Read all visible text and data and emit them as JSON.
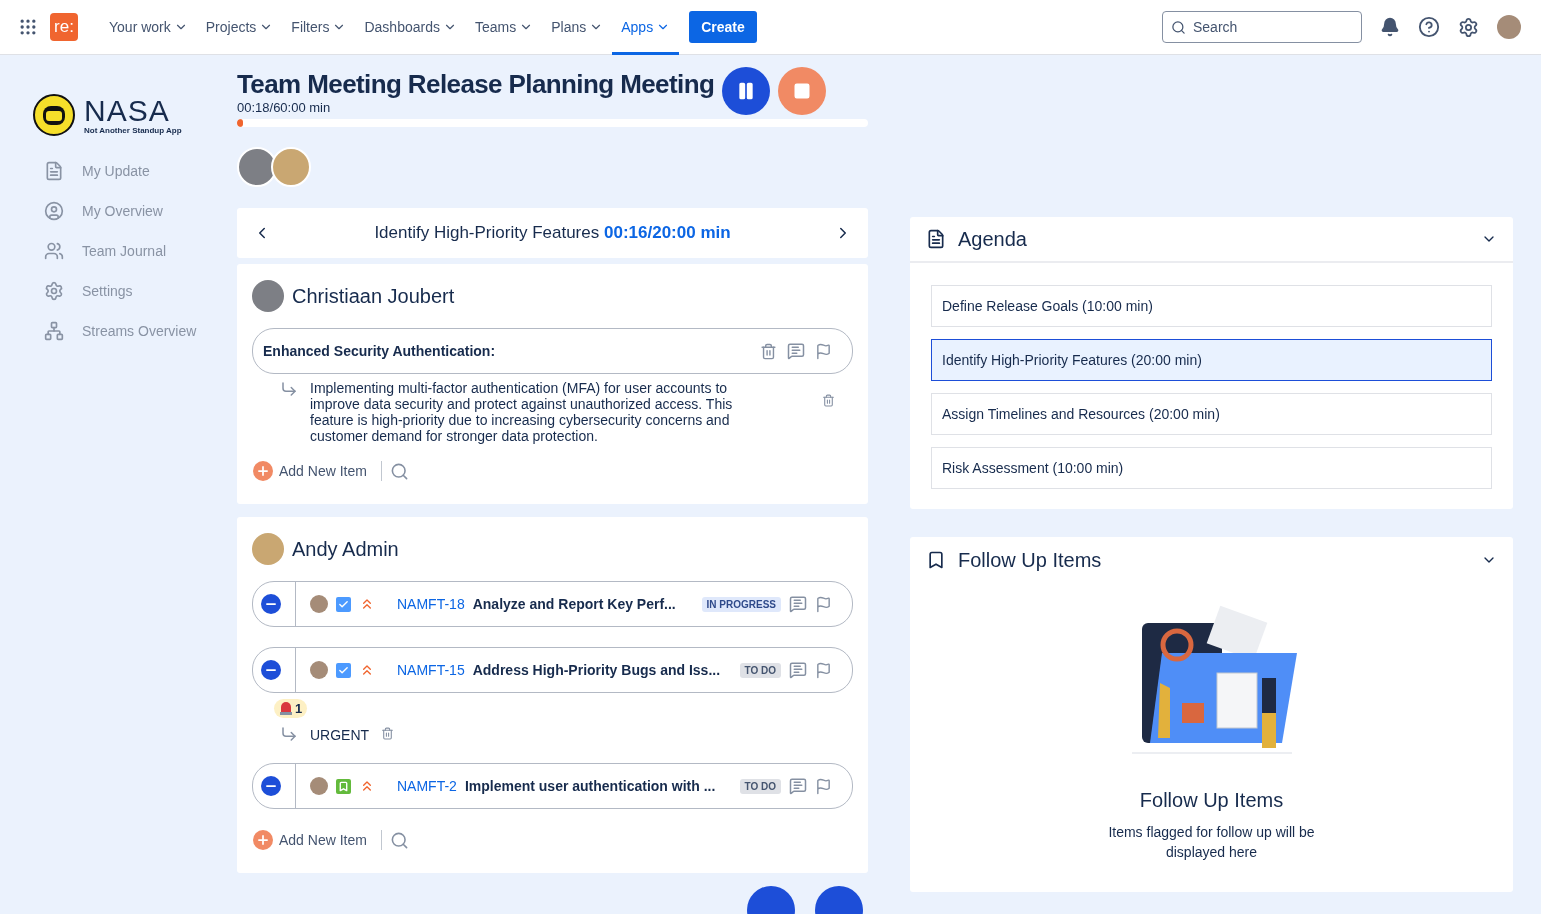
{
  "nav": {
    "logo": "re:",
    "items": [
      {
        "label": "Your work",
        "selected": false
      },
      {
        "label": "Projects",
        "selected": false
      },
      {
        "label": "Filters",
        "selected": false
      },
      {
        "label": "Dashboards",
        "selected": false
      },
      {
        "label": "Teams",
        "selected": false
      },
      {
        "label": "Plans",
        "selected": false
      },
      {
        "label": "Apps",
        "selected": true
      }
    ],
    "create": "Create",
    "search": {
      "placeholder": "Search"
    }
  },
  "sidebar": {
    "logo": {
      "title": "NASA",
      "subtitle": "Not Another Standup App"
    },
    "items": [
      {
        "label": "My Update",
        "kind": "document"
      },
      {
        "label": "My Overview",
        "kind": "user"
      },
      {
        "label": "Team Journal",
        "kind": "team"
      },
      {
        "label": "Settings",
        "kind": "settings"
      },
      {
        "label": "Streams Overview",
        "kind": "hierarchy"
      }
    ]
  },
  "meeting": {
    "title": "Team Meeting Release Planning Meeting",
    "timer": "00:18/60:00 min",
    "level": 0.005
  },
  "topic": {
    "title": "Identify High-Priority Features",
    "time": "00:16/20:00 min"
  },
  "updates": [
    {
      "name": "Christiaan Joubert",
      "add_label": "Add New Item",
      "items": [
        {
          "kind": "note",
          "title": "Enhanced Security Authentication:",
          "comments": [
            {
              "text": "Implementing multi-factor authentication (MFA) for user accounts to improve data security and protect against unauthorized access. This feature is high-priority due to increasing cybersecurity concerns and customer demand for stronger data protection."
            }
          ]
        }
      ]
    },
    {
      "name": "Andy Admin",
      "add_label": "Add New Item",
      "items": [
        {
          "kind": "task",
          "key": "NAMFT-18",
          "summary": "Analyze and Report Key Perf...",
          "status": "IN PROGRESS",
          "in_progress": true
        },
        {
          "kind": "task",
          "key": "NAMFT-15",
          "summary": "Address High-Priority Bugs and Iss...",
          "status": "TO DO",
          "in_progress": false,
          "alert_count": "1",
          "comments": [
            {
              "text": "URGENT"
            }
          ]
        },
        {
          "kind": "story",
          "key": "NAMFT-2",
          "summary": "Implement user authentication with ...",
          "status": "TO DO",
          "in_progress": false
        }
      ]
    }
  ],
  "agenda": {
    "title": "Agenda",
    "items": [
      {
        "label": "Define Release Goals (10:00 min)",
        "selected": false
      },
      {
        "label": "Identify High-Priority Features (20:00 min)",
        "selected": true
      },
      {
        "label": "Assign Timelines and Resources (20:00 min)",
        "selected": false
      },
      {
        "label": "Risk Assessment (10:00 min)",
        "selected": false
      }
    ]
  },
  "follow_up": {
    "title": "Follow Up Items",
    "empty_title": "Follow Up Items",
    "empty_text": "Items flagged for follow up will be displayed here"
  }
}
